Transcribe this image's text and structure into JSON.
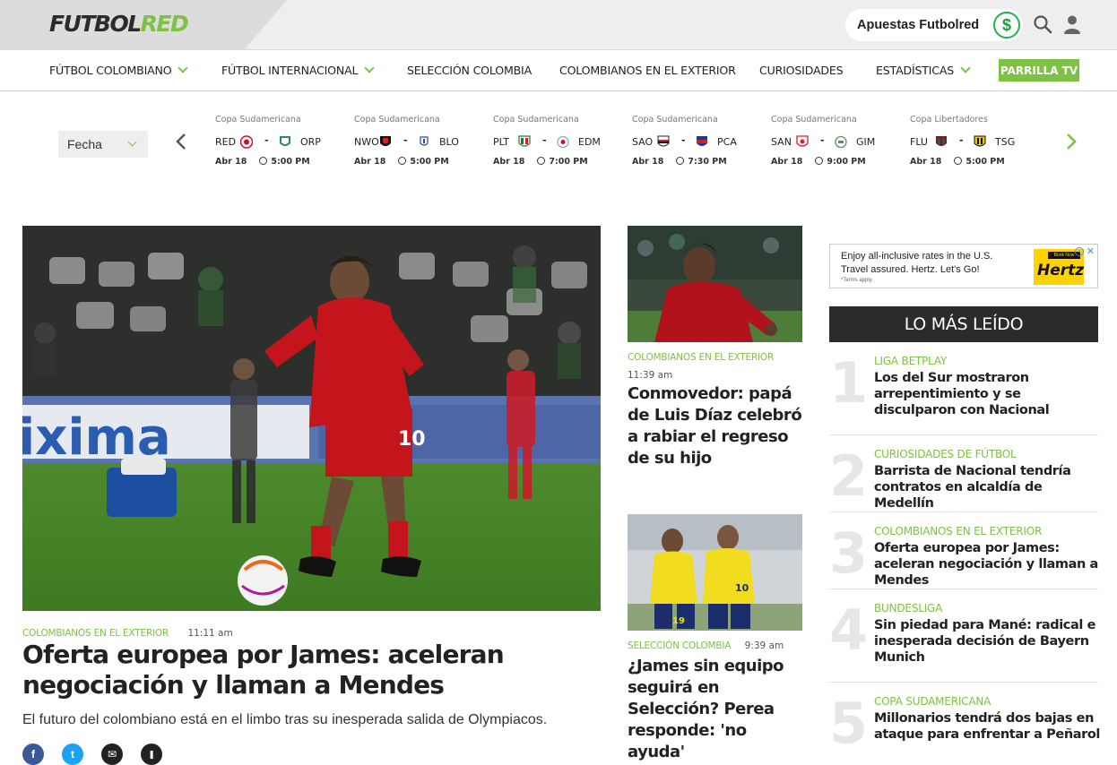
{
  "header": {
    "logo_part1": "FUTBOL",
    "logo_part2": "RED",
    "bet_label": "Apuestas Futbolred",
    "bet_icon": "dollar-icon",
    "search_icon": "search-icon",
    "user_icon": "user-icon"
  },
  "nav": {
    "items": [
      {
        "label": "FÚTBOL COLOMBIANO",
        "has_dropdown": true
      },
      {
        "label": "FÚTBOL INTERNACIONAL",
        "has_dropdown": true
      },
      {
        "label": "SELECCIÓN COLOMBIA",
        "has_dropdown": false
      },
      {
        "label": "COLOMBIANOS EN EL EXTERIOR",
        "has_dropdown": false
      },
      {
        "label": "CURIOSIDADES",
        "has_dropdown": false
      },
      {
        "label": "ESTADÍSTICAS",
        "has_dropdown": true
      }
    ],
    "cta": "PARRILLA TV"
  },
  "scores": {
    "date_select": "Fecha",
    "matches": [
      {
        "competition": "Copa Sudamericana",
        "home": "RED",
        "away": "ORP",
        "date": "Abr 18",
        "time": "5:00 PM"
      },
      {
        "competition": "Copa Sudamericana",
        "home": "NWO",
        "away": "BLO",
        "date": "Abr 18",
        "time": "5:00 PM"
      },
      {
        "competition": "Copa Sudamericana",
        "home": "PLT",
        "away": "EDM",
        "date": "Abr 18",
        "time": "7:00 PM"
      },
      {
        "competition": "Copa Sudamericana",
        "home": "SAO",
        "away": "PCA",
        "date": "Abr 18",
        "time": "7:30 PM"
      },
      {
        "competition": "Copa Sudamericana",
        "home": "SAN",
        "away": "GIM",
        "date": "Abr 18",
        "time": "9:00 PM"
      },
      {
        "competition": "Copa Libertadores",
        "home": "FLU",
        "away": "TSG",
        "date": "Abr 18",
        "time": "5:00 PM"
      }
    ],
    "separator": "-"
  },
  "hero": {
    "category": "COLOMBIANOS EN EL EXTERIOR",
    "time": "11:11 am",
    "title": "Oferta europea por James: aceleran negociación y llaman a Mendes",
    "subtitle": "El futuro del colombiano está en el limbo tras su inesperada salida de Olympiacos.",
    "image_text": "ixima",
    "shirt_number": "10",
    "share": [
      {
        "icon": "facebook-icon",
        "glyph": "f",
        "color": "#3b5998"
      },
      {
        "icon": "twitter-icon",
        "glyph": "t",
        "color": "#1da1f2"
      },
      {
        "icon": "email-icon",
        "glyph": "✉",
        "color": "#222222"
      },
      {
        "icon": "bookmark-icon",
        "glyph": "❚",
        "color": "#222222"
      }
    ]
  },
  "middle": [
    {
      "category": "COLOMBIANOS EN EL EXTERIOR",
      "time": "11:39 am",
      "title": "Conmovedor: papá de Luis Díaz celebró a rabiar el regreso de su hijo"
    },
    {
      "category": "SELECCIÓN COLOMBIA",
      "time": "9:39 am",
      "title": "¿James sin equipo seguirá en Selección? Perea responde: 'no ayuda'",
      "shirt_numbers": [
        "19",
        "10"
      ]
    }
  ],
  "ad": {
    "line1": "Enjoy all-inclusive rates in the U.S.",
    "line2": "Travel assured. Hertz. Let's Go!",
    "terms": "*Terms apply.",
    "brand": "Hertz",
    "brand_button": "Book Now",
    "info": "i",
    "close": "✕"
  },
  "most_read": {
    "title": "LO MÁS LEÍDO",
    "items": [
      {
        "rank": "1",
        "category": "LIGA BETPLAY",
        "title": "Los del Sur mostraron arrepentimiento y se disculparon con Nacional"
      },
      {
        "rank": "2",
        "category": "CURIOSIDADES DE FÚTBOL",
        "title": "Barrista de Nacional tendría contratos en alcaldía de Medellín"
      },
      {
        "rank": "3",
        "category": "COLOMBIANOS EN EL EXTERIOR",
        "title": "Oferta europea por James: aceleran negociación y llaman a Mendes"
      },
      {
        "rank": "4",
        "category": "BUNDESLIGA",
        "title": "Sin piedad para Mané: radical e inesperada decisión de Bayern Munich"
      },
      {
        "rank": "5",
        "category": "COPA SUDAMERICANA",
        "title": "Millonarios tendrá dos bajas en ataque para enfrentar a Peñarol"
      }
    ]
  }
}
